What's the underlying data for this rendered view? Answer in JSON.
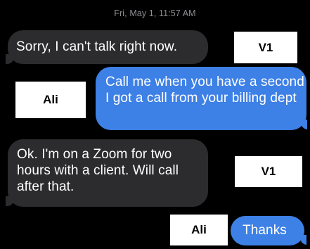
{
  "thread": {
    "timestamp": "Fri, May 1, 11:57 AM",
    "messages": [
      {
        "direction": "incoming",
        "text": "Sorry, I can't talk right now."
      },
      {
        "direction": "outgoing",
        "text": "Call me when you have a second I got a call from your billing dept"
      },
      {
        "direction": "incoming",
        "text": "Ok. I'm on a Zoom for two hours with a client. Will call after that."
      },
      {
        "direction": "outgoing",
        "text": "Thanks"
      }
    ]
  },
  "annotations": [
    {
      "label": "V1"
    },
    {
      "label": "Ali"
    },
    {
      "label": "V1"
    },
    {
      "label": "Ali"
    }
  ],
  "colors": {
    "background": "#000000",
    "incoming_bubble": "#2c2c2e",
    "outgoing_bubble": "#3d80e6",
    "timestamp_text": "#8e8e93",
    "label_background": "#ffffff"
  }
}
